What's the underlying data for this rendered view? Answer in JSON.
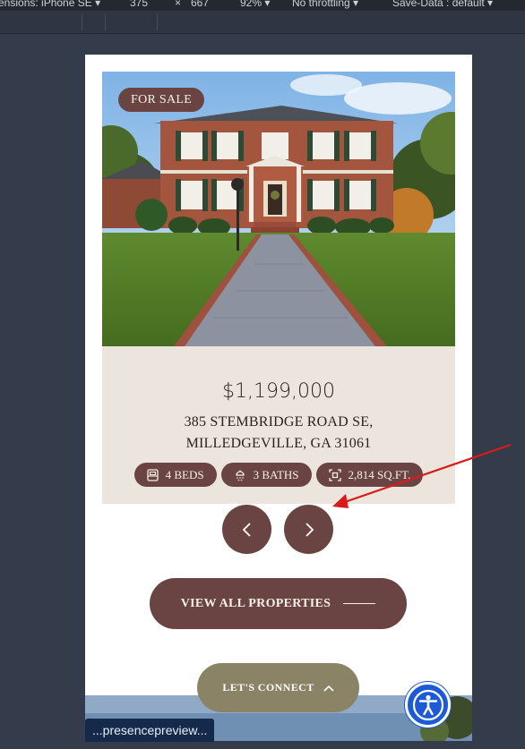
{
  "devtools": {
    "dimensions_label": "ensions: iPhone SE ▾",
    "width": "375",
    "times": "×",
    "height": "667",
    "zoom": "92% ▾",
    "throttling": "No throttling ▾",
    "save_data": "Save-Data : default ▾"
  },
  "listing": {
    "status_badge": "FOR SALE",
    "price": "$1,199,000",
    "address_line1": "385 STEMBRIDGE ROAD SE,",
    "address_line2": "MILLEDGEVILLE, GA 31061",
    "features": [
      {
        "icon": "bed-icon",
        "label": "4 BEDS"
      },
      {
        "icon": "shower-icon",
        "label": "3 BATHS"
      },
      {
        "icon": "area-icon",
        "label": "2,814 SQ.FT."
      }
    ]
  },
  "carousel": {
    "prev_icon": "chevron-left-icon",
    "next_icon": "chevron-right-icon"
  },
  "cta": {
    "view_all_label": "VIEW ALL PROPERTIES",
    "lets_connect_label": "LET'S CONNECT"
  },
  "accessibility": {
    "icon": "accessibility-icon"
  },
  "status_bar": {
    "url": "...presencepreview..."
  },
  "colors": {
    "accent": "#6a4442",
    "card_bg": "#ebe5dd",
    "connect_bg": "#8b8365",
    "a11y_blue": "#1d5bd6",
    "annotation_red": "#d81b1b"
  }
}
